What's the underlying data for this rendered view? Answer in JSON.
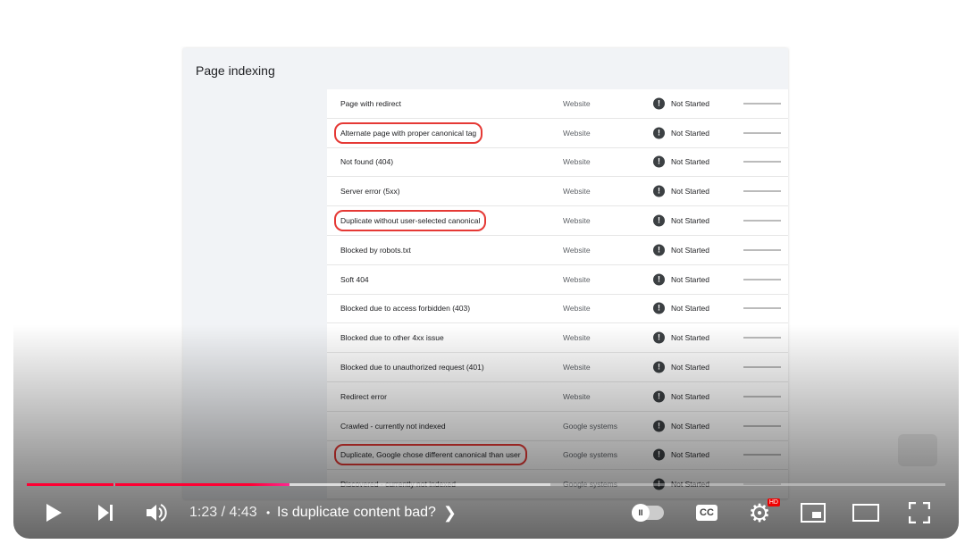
{
  "panel": {
    "title": "Page indexing"
  },
  "rows": [
    {
      "name": "Page with redirect",
      "source": "Website",
      "status": "Not Started",
      "highlight": false
    },
    {
      "name": "Alternate page with proper canonical tag",
      "source": "Website",
      "status": "Not Started",
      "highlight": true
    },
    {
      "name": "Not found (404)",
      "source": "Website",
      "status": "Not Started",
      "highlight": false
    },
    {
      "name": "Server error (5xx)",
      "source": "Website",
      "status": "Not Started",
      "highlight": false
    },
    {
      "name": "Duplicate without user-selected canonical",
      "source": "Website",
      "status": "Not Started",
      "highlight": true
    },
    {
      "name": "Blocked by robots.txt",
      "source": "Website",
      "status": "Not Started",
      "highlight": false
    },
    {
      "name": "Soft 404",
      "source": "Website",
      "status": "Not Started",
      "highlight": false
    },
    {
      "name": "Blocked due to access forbidden (403)",
      "source": "Website",
      "status": "Not Started",
      "highlight": false
    },
    {
      "name": "Blocked due to other 4xx issue",
      "source": "Website",
      "status": "Not Started",
      "highlight": false
    },
    {
      "name": "Blocked due to unauthorized request (401)",
      "source": "Website",
      "status": "Not Started",
      "highlight": false
    },
    {
      "name": "Redirect error",
      "source": "Website",
      "status": "Not Started",
      "highlight": false
    },
    {
      "name": "Crawled - currently not indexed",
      "source": "Google systems",
      "status": "Not Started",
      "highlight": false
    },
    {
      "name": "Duplicate, Google chose different canonical than user",
      "source": "Google systems",
      "status": "Not Started",
      "highlight": true
    },
    {
      "name": "Discovered - currently not indexed",
      "source": "Google systems",
      "status": "Not Started",
      "highlight": false
    }
  ],
  "player": {
    "time": "1:23 / 4:43",
    "separator": "•",
    "title": "Is duplicate content bad?",
    "hd_badge": "HD",
    "cc_label": "CC",
    "progress_fraction": 0.286,
    "accent": "#ff0033",
    "highlight_color": "#e53935"
  }
}
